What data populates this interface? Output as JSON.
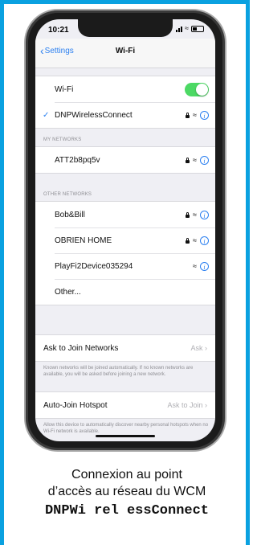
{
  "status": {
    "time": "10:21"
  },
  "nav": {
    "back_label": "Settings",
    "title": "Wi-Fi"
  },
  "wifi": {
    "label": "Wi-Fi",
    "enabled": true,
    "connected_network": "DNPWirelessConnect"
  },
  "my_networks": {
    "header": "MY NETWORKS",
    "items": [
      {
        "name": "ATT2b8pq5v",
        "locked": true
      }
    ]
  },
  "other_networks": {
    "header": "OTHER NETWORKS",
    "items": [
      {
        "name": "Bob&Bill",
        "locked": true
      },
      {
        "name": "OBRIEN HOME",
        "locked": true
      },
      {
        "name": "PlayFi2Device035294",
        "locked": false
      }
    ],
    "other_label": "Other..."
  },
  "ask_to_join": {
    "label": "Ask to Join Networks",
    "value": "Ask",
    "footnote": "Known networks will be joined automatically. If no known networks are available, you will be asked before joining a new network."
  },
  "auto_join": {
    "label": "Auto-Join Hotspot",
    "value": "Ask to Join",
    "footnote": "Allow this device to automatically discover nearby personal hotspots when no Wi-Fi network is available."
  },
  "caption": {
    "line1": "Connexion au point",
    "line2": "d’accès au réseau du WCM",
    "line3": "DNPWi rel essConnect"
  },
  "colors": {
    "accent_blue": "#2a7ff0",
    "toggle_green": "#4cd964",
    "frame_blue": "#0aa1e0"
  },
  "icons": [
    "back-chevron",
    "check",
    "lock",
    "wifi",
    "info",
    "toggle",
    "signal",
    "battery"
  ]
}
